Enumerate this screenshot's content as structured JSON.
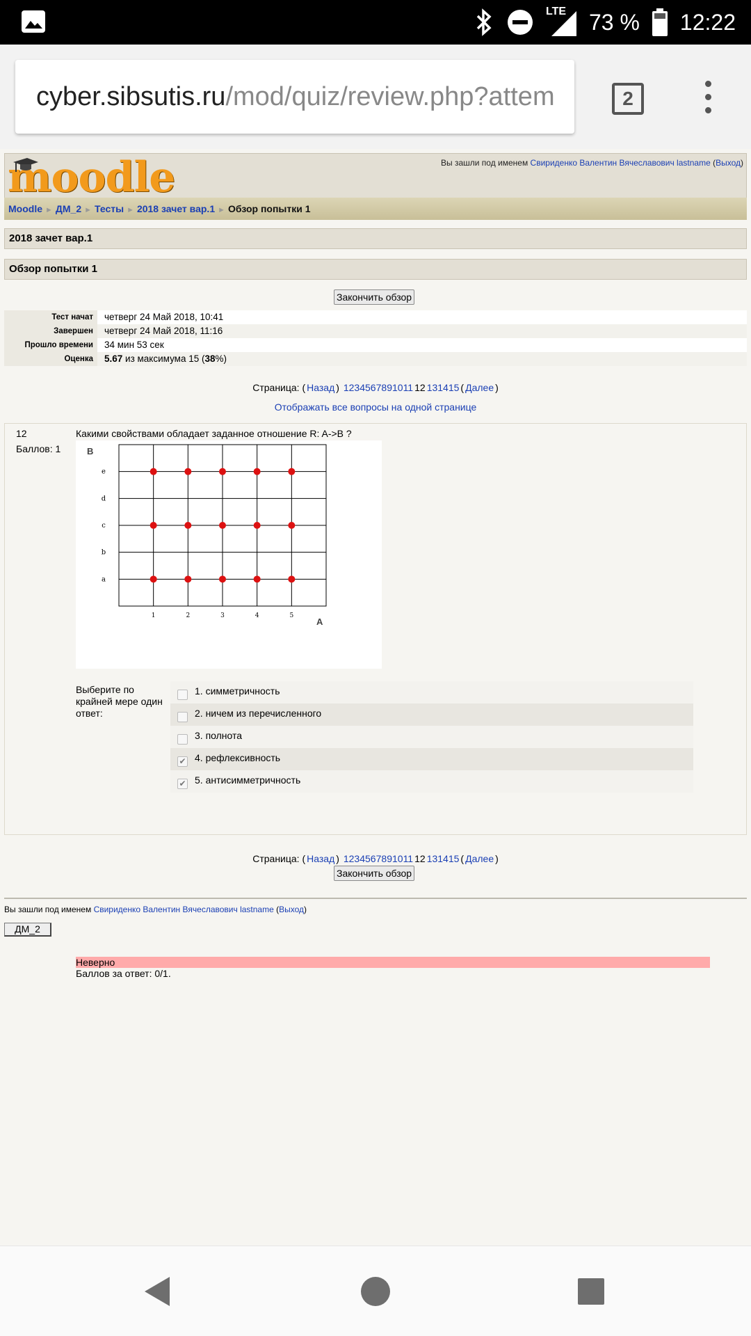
{
  "status_bar": {
    "battery": "73 %",
    "time": "12:22",
    "network": "LTE",
    "icons": [
      "image-icon",
      "bluetooth-icon",
      "dnd-icon",
      "signal-icon",
      "battery-icon"
    ]
  },
  "browser": {
    "url_host": "cyber.sibsutis.ru",
    "url_path": "/mod/quiz/review.php?attem",
    "tab_count": "2"
  },
  "header": {
    "logo_text": "moodle",
    "logged_prefix": "Вы зашли под именем ",
    "user_name": "Свириденко Валентин Вячеславович lastname",
    "logout_open": " (",
    "logout": "Выход",
    "logout_close": ")"
  },
  "breadcrumb": [
    "Moodle",
    "ДМ_2",
    "Тесты",
    "2018 зачет вар.1",
    "Обзор попытки 1"
  ],
  "quiz_title": "2018 зачет вар.1",
  "review_title": "Обзор попытки 1",
  "finish_button": "Закончить обзор",
  "info": [
    {
      "key": "Тест начат",
      "value": "четверг 24 Май 2018, 10:41"
    },
    {
      "key": "Завершен",
      "value": "четверг 24 Май 2018, 11:16"
    },
    {
      "key": "Прошло времени",
      "value": "34 мин 53 сек"
    },
    {
      "key": "Оценка",
      "value_bold": "5.67",
      "value_mid": " из максимума 15 (",
      "value_bold2": "38",
      "value_end": "%)"
    }
  ],
  "paging": {
    "label": "Страница: (",
    "prev": "Назад",
    "close_paren": ")",
    "pages": [
      "1",
      "2",
      "3",
      "4",
      "5",
      "6",
      "7",
      "8",
      "9",
      "10",
      "11",
      "12",
      "13",
      "14",
      "15"
    ],
    "current": "12",
    "open_paren": "(",
    "next": "Далее",
    "end_paren": ")"
  },
  "show_all": "Отображать все вопросы на одной странице",
  "question": {
    "number": "12",
    "grade": "Баллов: 1",
    "text": "Какими свойствами обладает заданное отношение R: A->B ?",
    "prompt": "Выберите по крайней мере один ответ:",
    "answers": [
      {
        "label": "1. симметричность",
        "checked": false
      },
      {
        "label": "2. ничем из перечисленного",
        "checked": false
      },
      {
        "label": "3. полнота",
        "checked": false
      },
      {
        "label": "4. рефлексивность",
        "checked": true
      },
      {
        "label": "5. антисимметричность",
        "checked": true
      }
    ],
    "result": "Неверно",
    "score": "Баллов за ответ: 0/1."
  },
  "chart_data": {
    "type": "scatter",
    "xlabel": "A",
    "ylabel": "B",
    "x_categories": [
      "1",
      "2",
      "3",
      "4",
      "5"
    ],
    "y_categories": [
      "a",
      "b",
      "c",
      "d",
      "e"
    ],
    "points": [
      {
        "x": "1",
        "y": "a"
      },
      {
        "x": "2",
        "y": "a"
      },
      {
        "x": "3",
        "y": "a"
      },
      {
        "x": "4",
        "y": "a"
      },
      {
        "x": "5",
        "y": "a"
      },
      {
        "x": "1",
        "y": "c"
      },
      {
        "x": "2",
        "y": "c"
      },
      {
        "x": "3",
        "y": "c"
      },
      {
        "x": "4",
        "y": "c"
      },
      {
        "x": "5",
        "y": "c"
      },
      {
        "x": "1",
        "y": "e"
      },
      {
        "x": "2",
        "y": "e"
      },
      {
        "x": "3",
        "y": "e"
      },
      {
        "x": "4",
        "y": "e"
      },
      {
        "x": "5",
        "y": "e"
      }
    ],
    "grid": true,
    "point_color": "#dd1111"
  },
  "footer": {
    "logged_prefix": "Вы зашли под именем ",
    "user_name": "Свириденко Валентин Вячеславович lastname",
    "logout_open": " (",
    "logout": "Выход",
    "logout_close": ")",
    "course_button": "ДМ_2"
  }
}
